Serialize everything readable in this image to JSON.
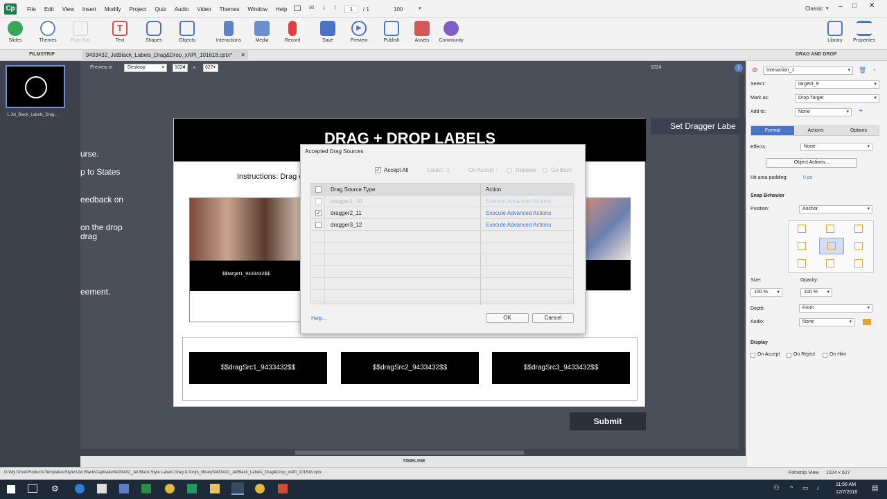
{
  "app": {
    "logo": "Cp",
    "menu": [
      "File",
      "Edit",
      "View",
      "Insert",
      "Modify",
      "Project",
      "Quiz",
      "Audio",
      "Video",
      "Themes",
      "Window",
      "Help"
    ],
    "page_current": "1",
    "page_total": "/ 1",
    "zoom": "100",
    "workspace": "Classic"
  },
  "toolbar": {
    "items": [
      {
        "label": "Slides",
        "icon": "plus-icon"
      },
      {
        "label": "Themes",
        "icon": "palette-icon"
      },
      {
        "label": "Fluid Box",
        "icon": "fluidbox-icon"
      },
      {
        "label": "Text",
        "icon": "text-icon"
      },
      {
        "label": "Shapes",
        "icon": "shapes-icon"
      },
      {
        "label": "Objects",
        "icon": "objects-icon"
      },
      {
        "label": "Interactions",
        "icon": "hand-icon"
      },
      {
        "label": "Media",
        "icon": "image-icon"
      },
      {
        "label": "Record",
        "icon": "mic-icon"
      },
      {
        "label": "Save",
        "icon": "save-icon"
      },
      {
        "label": "Preview",
        "icon": "play-icon"
      },
      {
        "label": "Publish",
        "icon": "publish-icon"
      },
      {
        "label": "Assets",
        "icon": "assets-icon"
      },
      {
        "label": "Community",
        "icon": "community-icon"
      }
    ],
    "right_items": [
      {
        "label": "Library",
        "icon": "library-icon"
      },
      {
        "label": "Properties",
        "icon": "properties-icon"
      }
    ]
  },
  "panels": {
    "filmstrip_title": "FILMSTRIP",
    "tab_title": "9433432_JetBlack_Labels_Drag&Drop_xAPI_101618.cptx*",
    "right_title": "DRAG AND DROP",
    "thumb_label": "1 Jet_Black_Labels_Drag...",
    "timeline": "TIMELINE"
  },
  "stage": {
    "preview_label": "Preview in",
    "preview_device": "Desktop",
    "width": "1024",
    "height": "627",
    "ruler_marker": "1024"
  },
  "slide": {
    "title": "DRAG + DROP LABELS",
    "instructions": "Instructions: Drag e",
    "target_label": "$$target1_9433432$$",
    "drag_sources": [
      "$$dragSrc1_9433432$$",
      "$$dragSrc2_9433432$$",
      "$$dragSrc3_9433432$$"
    ],
    "submit": "Submit",
    "right_banner": "Set Dragger Labe",
    "side_texts": [
      "urse.",
      "p to States",
      "eedback on",
      "on the drop",
      "drag",
      "eement."
    ]
  },
  "dialog": {
    "title": "Accepted Drag Sources",
    "accept_all": "Accept All",
    "count": "Count: -1",
    "on_accept": "On Accept :",
    "replace": "Replace",
    "go_back": "Go Back",
    "col_source": "Drag Source Type",
    "col_action": "Action",
    "rows": [
      {
        "name": "dragger1_10",
        "action": "Execute Advanced Actions",
        "checked": false,
        "enabled": false
      },
      {
        "name": "dragger2_11",
        "action": "Execute Advanced Actions",
        "checked": true,
        "enabled": true
      },
      {
        "name": "dragger3_12",
        "action": "Execute Advanced Actions",
        "checked": false,
        "enabled": true
      }
    ],
    "help": "Help...",
    "ok": "OK",
    "cancel": "Cancel"
  },
  "properties": {
    "interaction_name": "Interaction_1",
    "select_label": "Select:",
    "select_value": "target3_9",
    "mark_as_label": "Mark as:",
    "mark_as_value": "Drop Target",
    "add_to_label": "Add to:",
    "add_to_value": "None",
    "tabs": [
      "Format",
      "Actions",
      "Options"
    ],
    "effects_label": "Effects:",
    "effects_value": "None",
    "object_actions": "Object Actions...",
    "hit_area_label": "Hit area padding:",
    "hit_area_value": "0 px",
    "snap_behavior": "Snap Behavior",
    "position_label": "Position:",
    "position_value": "Anchor",
    "size_label": "Size:",
    "size_value": "100 %",
    "opacity_label": "Opacity:",
    "opacity_value": "100 %",
    "depth_label": "Depth:",
    "depth_value": "Front",
    "audio_label": "Audio:",
    "audio_value": "None",
    "display_label": "Display",
    "display_options": [
      "On Accept",
      "On Reject",
      "On Hint"
    ]
  },
  "status": {
    "path": "G:\\My Drive\\Products\\Templates\\Styles\\Jet Black\\Captivate\\9433432_Jet Black Style Labels Drag & Drop\\_library\\9433432_JetBlack_Labels_Drag&Drop_xAPI_101618.cptx",
    "view": "Filmstrip View",
    "dims": "1024 x 627"
  },
  "taskbar": {
    "time": "11:56 AM",
    "date": "12/7/2018"
  },
  "colors": {
    "accent": "#3a74c9",
    "brand": "#1d7b45"
  }
}
